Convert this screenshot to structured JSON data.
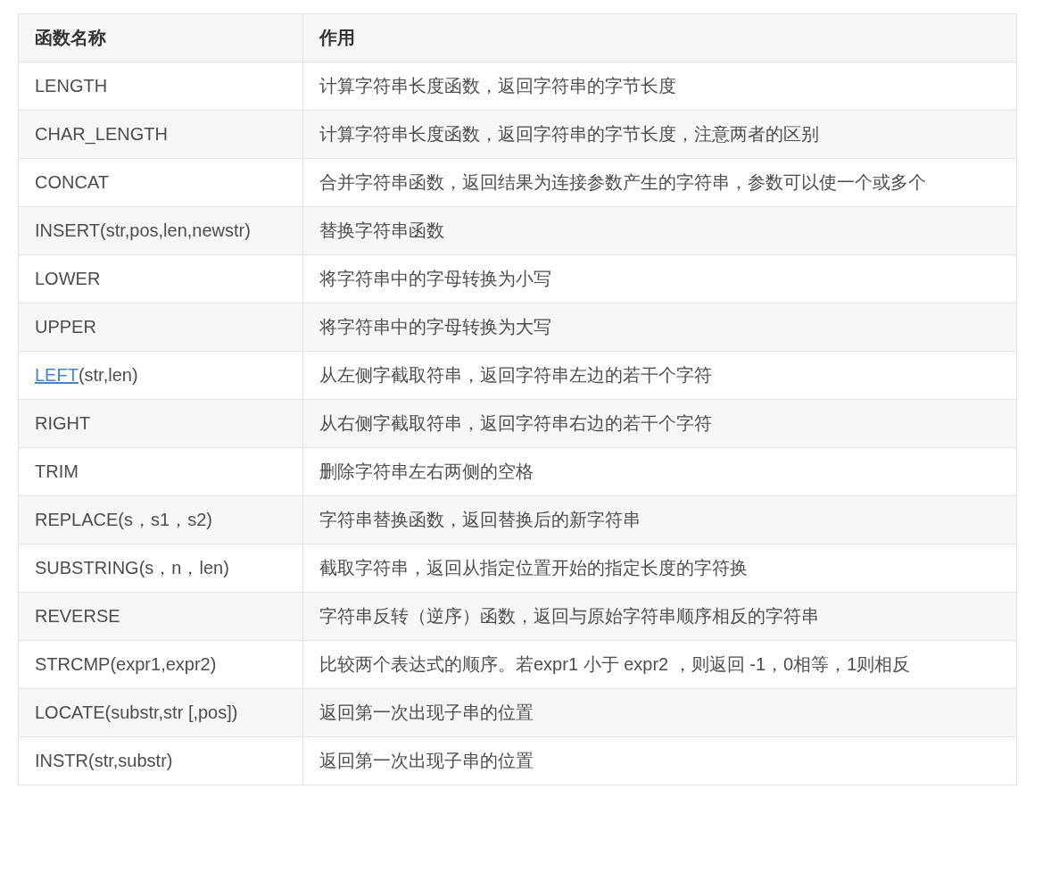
{
  "table": {
    "columns": [
      "函数名称",
      "作用"
    ],
    "rows": [
      {
        "name": "LENGTH",
        "description": "计算字符串长度函数，返回字符串的字节长度"
      },
      {
        "name": "CHAR_LENGTH",
        "description": "计算字符串长度函数，返回字符串的字节长度，注意两者的区别"
      },
      {
        "name": "CONCAT",
        "description": "合并字符串函数，返回结果为连接参数产生的字符串，参数可以使一个或多个"
      },
      {
        "name": "INSERT(str,pos,len,newstr)",
        "description": "替换字符串函数"
      },
      {
        "name": "LOWER",
        "description": "将字符串中的字母转换为小写"
      },
      {
        "name": "UPPER",
        "description": "将字符串中的字母转换为大写"
      },
      {
        "name_link": "LEFT",
        "name": "(str,len)",
        "description": "从左侧字截取符串，返回字符串左边的若干个字符"
      },
      {
        "name": "RIGHT",
        "description": "从右侧字截取符串，返回字符串右边的若干个字符"
      },
      {
        "name": "TRIM",
        "description": "删除字符串左右两侧的空格"
      },
      {
        "name": "REPLACE(s，s1，s2)",
        "description": "字符串替换函数，返回替换后的新字符串"
      },
      {
        "name": "SUBSTRING(s，n，len)",
        "description": "截取字符串，返回从指定位置开始的指定长度的字符换"
      },
      {
        "name": "REVERSE",
        "description": "字符串反转（逆序）函数，返回与原始字符串顺序相反的字符串"
      },
      {
        "name": "STRCMP(expr1,expr2)",
        "description": "比较两个表达式的顺序。若expr1 小于 expr2 ，则返回 -1，0相等，1则相反"
      },
      {
        "name": "LOCATE(substr,str [,pos])",
        "description": "返回第一次出现子串的位置"
      },
      {
        "name": "INSTR(str,substr)",
        "description": "返回第一次出现子串的位置"
      }
    ]
  }
}
